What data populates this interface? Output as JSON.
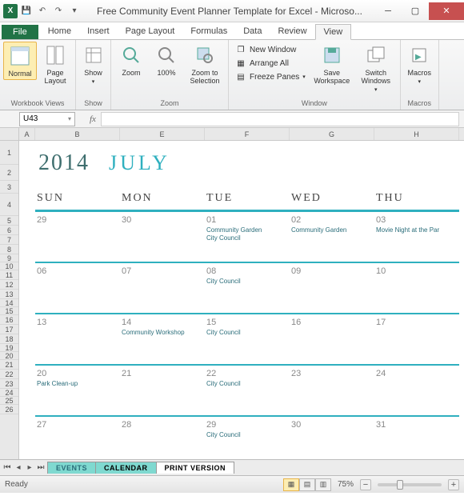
{
  "window": {
    "title": "Free Community Event Planner Template for Excel - Microso..."
  },
  "tabs": {
    "file": "File",
    "list": [
      "Home",
      "Insert",
      "Page Layout",
      "Formulas",
      "Data",
      "Review",
      "View"
    ],
    "active": "View"
  },
  "ribbon": {
    "workbook_views": {
      "label": "Workbook Views",
      "normal": "Normal",
      "page_layout": "Page Layout"
    },
    "show": {
      "label": "Show",
      "btn": "Show"
    },
    "zoom_group": {
      "label": "Zoom",
      "zoom": "Zoom",
      "hundred": "100%",
      "to_sel": "Zoom to Selection"
    },
    "window_group": {
      "label": "Window",
      "new_window": "New Window",
      "arrange_all": "Arrange All",
      "freeze": "Freeze Panes",
      "save_ws": "Save Workspace",
      "switch": "Switch Windows"
    },
    "macros": {
      "label": "Macros",
      "btn": "Macros"
    }
  },
  "namebox": "U43",
  "fx_label": "fx",
  "columns": [
    "A",
    "B",
    "E",
    "F",
    "G",
    "H"
  ],
  "row_numbers": [
    1,
    2,
    3,
    4,
    5,
    6,
    7,
    8,
    9,
    10,
    11,
    12,
    13,
    14,
    15,
    16,
    17,
    18,
    19,
    20,
    21,
    22,
    23,
    24,
    25,
    26
  ],
  "calendar": {
    "year": "2014",
    "month": "JULY",
    "daynames": [
      "SUN",
      "MON",
      "TUE",
      "WED",
      "THU"
    ],
    "weeks": [
      [
        {
          "d": "29",
          "ev": []
        },
        {
          "d": "30",
          "ev": []
        },
        {
          "d": "01",
          "ev": [
            "Community Garden",
            "City Council"
          ]
        },
        {
          "d": "02",
          "ev": [
            "Community Garden"
          ]
        },
        {
          "d": "03",
          "ev": [
            "Movie Night at the Par"
          ]
        }
      ],
      [
        {
          "d": "06",
          "ev": []
        },
        {
          "d": "07",
          "ev": []
        },
        {
          "d": "08",
          "ev": [
            "City Council"
          ]
        },
        {
          "d": "09",
          "ev": []
        },
        {
          "d": "10",
          "ev": []
        }
      ],
      [
        {
          "d": "13",
          "ev": []
        },
        {
          "d": "14",
          "ev": [
            "Community Workshop"
          ]
        },
        {
          "d": "15",
          "ev": [
            "City Council"
          ]
        },
        {
          "d": "16",
          "ev": []
        },
        {
          "d": "17",
          "ev": []
        }
      ],
      [
        {
          "d": "20",
          "ev": [
            "Park Clean-up"
          ]
        },
        {
          "d": "21",
          "ev": []
        },
        {
          "d": "22",
          "ev": [
            "City Council"
          ]
        },
        {
          "d": "23",
          "ev": []
        },
        {
          "d": "24",
          "ev": []
        }
      ],
      [
        {
          "d": "27",
          "ev": []
        },
        {
          "d": "28",
          "ev": []
        },
        {
          "d": "29",
          "ev": [
            "City Council"
          ]
        },
        {
          "d": "30",
          "ev": []
        },
        {
          "d": "31",
          "ev": []
        }
      ]
    ]
  },
  "sheets": [
    "EVENTS",
    "CALENDAR",
    "PRINT VERSION"
  ],
  "status": {
    "ready": "Ready",
    "zoom": "75%"
  }
}
